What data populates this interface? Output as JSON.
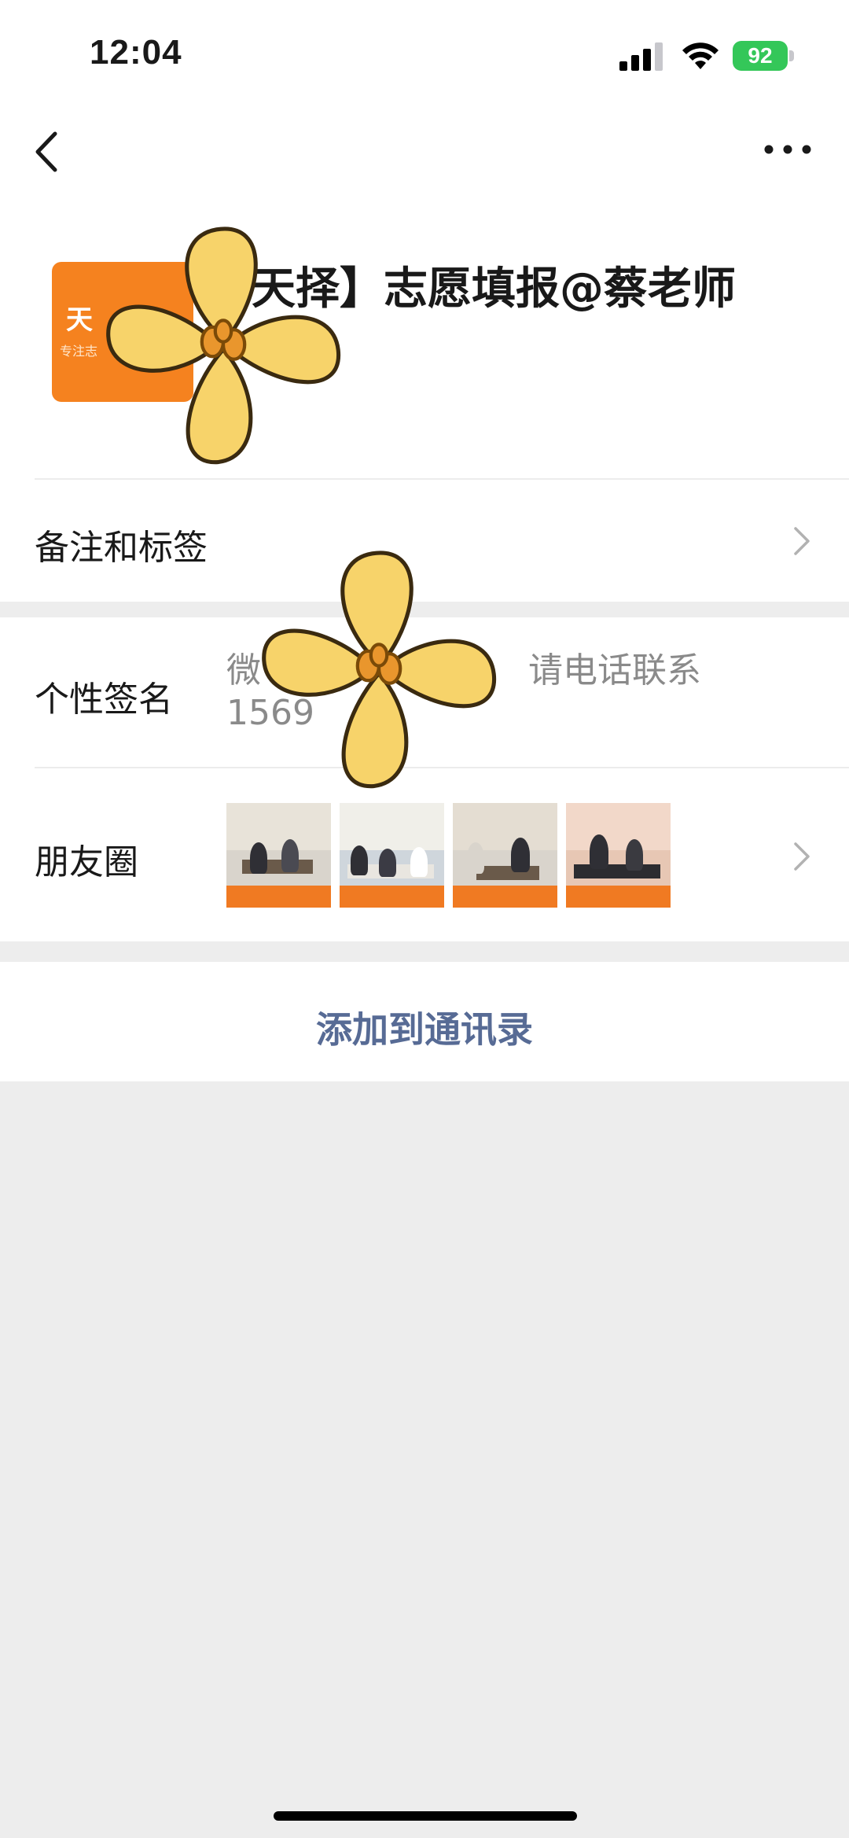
{
  "status_bar": {
    "time": "12:04",
    "battery": "92"
  },
  "nav": {
    "back_icon": "chevron-left-icon",
    "more_icon": "more-dots-icon"
  },
  "profile": {
    "name": "天择】志愿填报@蔡老师",
    "avatar_text": "天",
    "avatar_sub": "专注志",
    "avatar_color": "#f5821f"
  },
  "remark": {
    "label": "备注和标签"
  },
  "signature": {
    "label": "个性签名",
    "line1_start": "微",
    "line1_end": "请电话联系",
    "line2": "1569"
  },
  "moments": {
    "label": "朋友圈"
  },
  "actions": {
    "add_contact": "添加到通讯录",
    "accent": "#576b95"
  }
}
